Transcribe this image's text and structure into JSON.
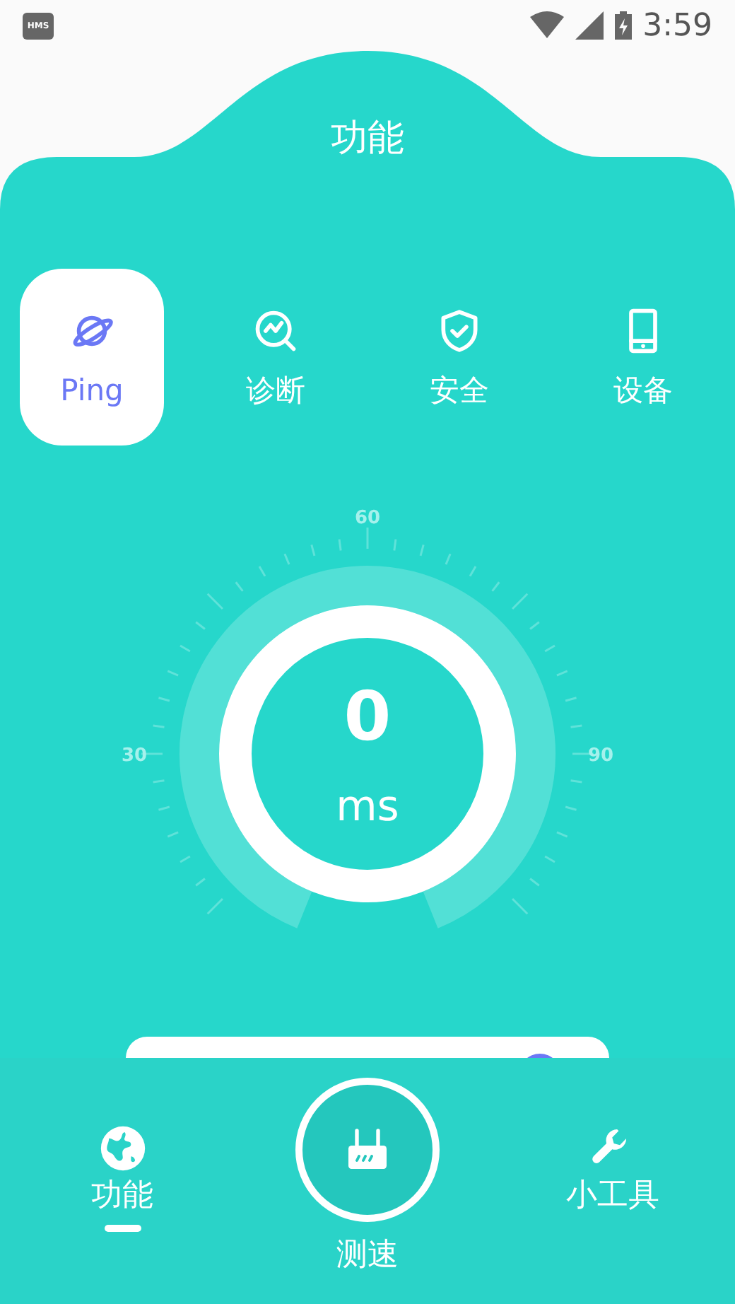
{
  "status_bar": {
    "app_badge": "HMS",
    "time": "3:59"
  },
  "header": {
    "title": "功能"
  },
  "tabs": [
    {
      "label": "Ping",
      "selected": true
    },
    {
      "label": "诊断",
      "selected": false
    },
    {
      "label": "安全",
      "selected": false
    },
    {
      "label": "设备",
      "selected": false
    }
  ],
  "gauge": {
    "value": "0",
    "unit": "ms",
    "scale_labels": [
      "30",
      "60",
      "90"
    ]
  },
  "bottom_nav": [
    {
      "label": "功能",
      "kind": "tab",
      "selected": true
    },
    {
      "label": "测速",
      "kind": "center",
      "selected": false
    },
    {
      "label": "小工具",
      "kind": "tab",
      "selected": false
    }
  ]
}
